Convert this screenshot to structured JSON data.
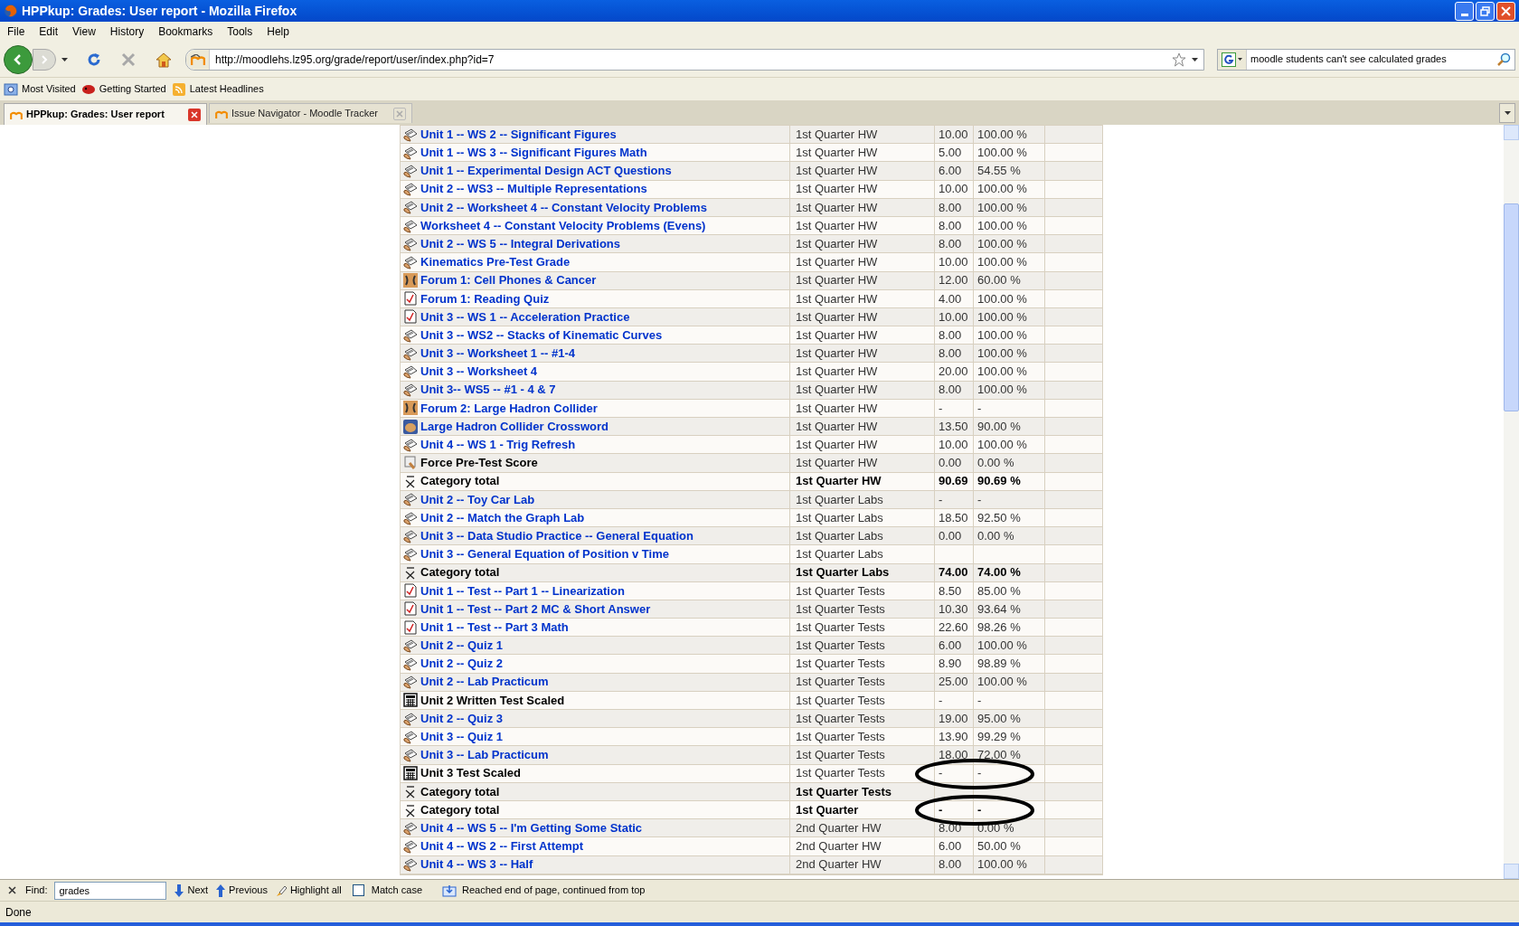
{
  "window": {
    "title": "HPPkup: Grades: User report - Mozilla Firefox"
  },
  "menu": [
    "File",
    "Edit",
    "View",
    "History",
    "Bookmarks",
    "Tools",
    "Help"
  ],
  "address_bar": {
    "value": "http://moodlehs.lz95.org/grade/report/user/index.php?id=7"
  },
  "search_bar": {
    "value": "moodle students can't see calculated grades"
  },
  "bookmarks": [
    {
      "label": "Most Visited",
      "kind": "folder"
    },
    {
      "label": "Getting Started",
      "kind": "page"
    },
    {
      "label": "Latest Headlines",
      "kind": "feed"
    }
  ],
  "tabs": [
    {
      "label": "HPPkup: Grades: User report",
      "selected": true
    },
    {
      "label": "Issue Navigator - Moodle Tracker",
      "selected": false
    }
  ],
  "grades_table": {
    "rows": [
      {
        "kind": "assignment",
        "name": "Unit 1 -- WS 2 -- Significant Figures",
        "link": true,
        "category": "1st Quarter HW",
        "grade": "10.00",
        "percent": "100.00 %",
        "total": false,
        "circled": false
      },
      {
        "kind": "assignment",
        "name": "Unit 1 -- WS 3 -- Significant Figures Math",
        "link": true,
        "category": "1st Quarter HW",
        "grade": "5.00",
        "percent": "100.00 %",
        "total": false,
        "circled": false
      },
      {
        "kind": "assignment",
        "name": "Unit 1 -- Experimental Design ACT Questions",
        "link": true,
        "category": "1st Quarter HW",
        "grade": "6.00",
        "percent": "54.55 %",
        "total": false,
        "circled": false
      },
      {
        "kind": "assignment",
        "name": "Unit 2 -- WS3 -- Multiple Representations",
        "link": true,
        "category": "1st Quarter HW",
        "grade": "10.00",
        "percent": "100.00 %",
        "total": false,
        "circled": false
      },
      {
        "kind": "assignment",
        "name": "Unit 2 -- Worksheet 4 -- Constant Velocity Problems",
        "link": true,
        "category": "1st Quarter HW",
        "grade": "8.00",
        "percent": "100.00 %",
        "total": false,
        "circled": false
      },
      {
        "kind": "assignment",
        "name": "Worksheet 4 -- Constant Velocity Problems (Evens)",
        "link": true,
        "category": "1st Quarter HW",
        "grade": "8.00",
        "percent": "100.00 %",
        "total": false,
        "circled": false
      },
      {
        "kind": "assignment",
        "name": "Unit 2 -- WS 5 -- Integral Derivations",
        "link": true,
        "category": "1st Quarter HW",
        "grade": "8.00",
        "percent": "100.00 %",
        "total": false,
        "circled": false
      },
      {
        "kind": "assignment",
        "name": "Kinematics Pre-Test Grade",
        "link": true,
        "category": "1st Quarter HW",
        "grade": "10.00",
        "percent": "100.00 %",
        "total": false,
        "circled": false
      },
      {
        "kind": "forum",
        "name": "Forum 1: Cell Phones & Cancer",
        "link": true,
        "category": "1st Quarter HW",
        "grade": "12.00",
        "percent": "60.00 %",
        "total": false,
        "circled": false
      },
      {
        "kind": "quiz",
        "name": "Forum 1: Reading Quiz",
        "link": true,
        "category": "1st Quarter HW",
        "grade": "4.00",
        "percent": "100.00 %",
        "total": false,
        "circled": false
      },
      {
        "kind": "quiz",
        "name": "Unit 3 -- WS 1 -- Acceleration Practice",
        "link": true,
        "category": "1st Quarter HW",
        "grade": "10.00",
        "percent": "100.00 %",
        "total": false,
        "circled": false
      },
      {
        "kind": "assignment",
        "name": "Unit 3 -- WS2 -- Stacks of Kinematic Curves",
        "link": true,
        "category": "1st Quarter HW",
        "grade": "8.00",
        "percent": "100.00 %",
        "total": false,
        "circled": false
      },
      {
        "kind": "assignment",
        "name": "Unit 3 -- Worksheet 1 -- #1-4",
        "link": true,
        "category": "1st Quarter HW",
        "grade": "8.00",
        "percent": "100.00 %",
        "total": false,
        "circled": false
      },
      {
        "kind": "assignment",
        "name": "Unit 3 -- Worksheet 4",
        "link": true,
        "category": "1st Quarter HW",
        "grade": "20.00",
        "percent": "100.00 %",
        "total": false,
        "circled": false
      },
      {
        "kind": "assignment",
        "name": "Unit 3-- WS5 -- #1 - 4 & 7",
        "link": true,
        "category": "1st Quarter HW",
        "grade": "8.00",
        "percent": "100.00 %",
        "total": false,
        "circled": false
      },
      {
        "kind": "forum",
        "name": "Forum 2: Large Hadron Collider",
        "link": true,
        "category": "1st Quarter HW",
        "grade": "-",
        "percent": "-",
        "total": false,
        "circled": false
      },
      {
        "kind": "crossword",
        "name": "Large Hadron Collider Crossword",
        "link": true,
        "category": "1st Quarter HW",
        "grade": "13.50",
        "percent": "90.00 %",
        "total": false,
        "circled": false
      },
      {
        "kind": "assignment",
        "name": "Unit 4 -- WS 1 - Trig Refresh",
        "link": true,
        "category": "1st Quarter HW",
        "grade": "10.00",
        "percent": "100.00 %",
        "total": false,
        "circled": false
      },
      {
        "kind": "manual",
        "name": "Force Pre-Test Score",
        "link": false,
        "category": "1st Quarter HW",
        "grade": "0.00",
        "percent": "0.00 %",
        "total": false,
        "circled": false
      },
      {
        "kind": "total",
        "name": "Category total",
        "link": false,
        "category": "1st Quarter HW",
        "grade": "90.69",
        "percent": "90.69 %",
        "total": true,
        "circled": false
      },
      {
        "kind": "assignment",
        "name": "Unit 2 -- Toy Car Lab",
        "link": true,
        "category": "1st Quarter Labs",
        "grade": "-",
        "percent": "-",
        "total": false,
        "circled": false
      },
      {
        "kind": "assignment",
        "name": "Unit 2 -- Match the Graph Lab",
        "link": true,
        "category": "1st Quarter Labs",
        "grade": "18.50",
        "percent": "92.50 %",
        "total": false,
        "circled": false
      },
      {
        "kind": "assignment",
        "name": "Unit 3 -- Data Studio Practice -- General Equation",
        "link": true,
        "category": "1st Quarter Labs",
        "grade": "0.00",
        "percent": "0.00 %",
        "total": false,
        "circled": false
      },
      {
        "kind": "assignment",
        "name": "Unit 3 -- General Equation of Position v Time",
        "link": true,
        "category": "1st Quarter Labs",
        "total": false,
        "circled": false
      },
      {
        "kind": "total",
        "name": "Category total",
        "link": false,
        "category": "1st Quarter Labs",
        "grade": "74.00",
        "percent": "74.00 %",
        "total": true,
        "circled": false
      },
      {
        "kind": "quiz",
        "name": "Unit 1 -- Test -- Part 1 -- Linearization",
        "link": true,
        "category": "1st Quarter Tests",
        "grade": "8.50",
        "percent": "85.00 %",
        "total": false,
        "circled": false
      },
      {
        "kind": "quiz",
        "name": "Unit 1 -- Test -- Part 2 MC & Short Answer",
        "link": true,
        "category": "1st Quarter Tests",
        "grade": "10.30",
        "percent": "93.64 %",
        "total": false,
        "circled": false
      },
      {
        "kind": "quiz",
        "name": "Unit 1 -- Test -- Part 3 Math",
        "link": true,
        "category": "1st Quarter Tests",
        "grade": "22.60",
        "percent": "98.26 %",
        "total": false,
        "circled": false
      },
      {
        "kind": "assignment",
        "name": "Unit 2 -- Quiz 1",
        "link": true,
        "category": "1st Quarter Tests",
        "grade": "6.00",
        "percent": "100.00 %",
        "total": false,
        "circled": false
      },
      {
        "kind": "assignment",
        "name": "Unit 2 -- Quiz 2",
        "link": true,
        "category": "1st Quarter Tests",
        "grade": "8.90",
        "percent": "98.89 %",
        "total": false,
        "circled": false
      },
      {
        "kind": "assignment",
        "name": "Unit 2 -- Lab Practicum",
        "link": true,
        "category": "1st Quarter Tests",
        "grade": "25.00",
        "percent": "100.00 %",
        "total": false,
        "circled": false
      },
      {
        "kind": "calculated",
        "name": "Unit 2 Written Test Scaled",
        "link": false,
        "category": "1st Quarter Tests",
        "grade": "-",
        "percent": "-",
        "total": false,
        "circled": false
      },
      {
        "kind": "assignment",
        "name": "Unit 2 -- Quiz 3",
        "link": true,
        "category": "1st Quarter Tests",
        "grade": "19.00",
        "percent": "95.00 %",
        "total": false,
        "circled": false
      },
      {
        "kind": "assignment",
        "name": "Unit 3 -- Quiz 1",
        "link": true,
        "category": "1st Quarter Tests",
        "grade": "13.90",
        "percent": "99.29 %",
        "total": false,
        "circled": false
      },
      {
        "kind": "assignment",
        "name": "Unit 3 -- Lab Practicum",
        "link": true,
        "category": "1st Quarter Tests",
        "grade": "18.00",
        "percent": "72.00 %",
        "total": false,
        "circled": false
      },
      {
        "kind": "calculated",
        "name": "Unit 3 Test Scaled",
        "link": false,
        "category": "1st Quarter Tests",
        "grade": "-",
        "percent": "-",
        "total": false,
        "circled": true
      },
      {
        "kind": "total",
        "name": "Category total",
        "link": false,
        "category": "1st Quarter Tests",
        "total": true,
        "circled": false
      },
      {
        "kind": "total",
        "name": "Category total",
        "link": false,
        "category": "1st Quarter",
        "grade": "-",
        "percent": "-",
        "total": true,
        "circled": true
      },
      {
        "kind": "assignment",
        "name": "Unit 4 -- WS 5 -- I'm Getting Some Static",
        "link": true,
        "category": "2nd Quarter HW",
        "grade": "8.00",
        "percent": "0.00 %",
        "total": false,
        "circled": false
      },
      {
        "kind": "assignment",
        "name": "Unit 4 -- WS 2 -- First Attempt",
        "link": true,
        "category": "2nd Quarter HW",
        "grade": "6.00",
        "percent": "50.00 %",
        "total": false,
        "circled": false
      },
      {
        "kind": "assignment",
        "name": "Unit 4 -- WS 3 -- Half",
        "link": true,
        "category": "2nd Quarter HW",
        "grade": "8.00",
        "percent": "100.00 %",
        "total": false,
        "circled": false
      }
    ]
  },
  "find_bar": {
    "label": "Find:",
    "value": "grades",
    "next": "Next",
    "previous": "Previous",
    "highlight": "Highlight all",
    "match_case": {
      "label": "Match case",
      "checked": false
    },
    "message": "Reached end of page, continued from top"
  },
  "status_bar": {
    "text": "Done"
  }
}
